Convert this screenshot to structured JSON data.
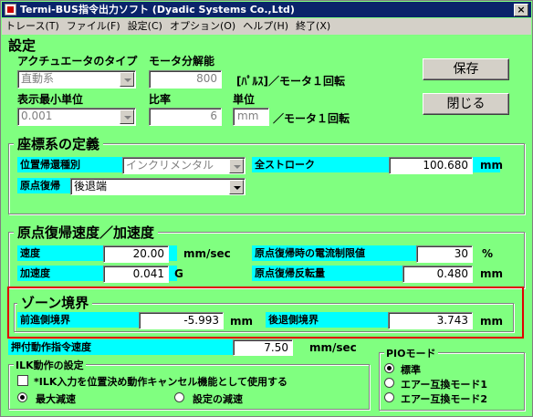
{
  "window": {
    "title": "Termi-BUS指令出力ソフト (Dyadic Systems Co.,Ltd)",
    "close": "×"
  },
  "menu": [
    "トレース(T)",
    "ファイル(F)",
    "設定(C)",
    "オプション(O)",
    "ヘルプ(H)",
    "終了(X)"
  ],
  "settings": {
    "title": "設定",
    "actuator_type_label": "アクチュエータのタイプ",
    "actuator_type_value": "直動系",
    "motor_resolution_label": "モータ分解能",
    "motor_resolution_value": "800",
    "pulse_unit": "[ﾊﾟﾙｽ]／モータ１回転",
    "min_unit_label": "表示最小単位",
    "min_unit_value": "0.001",
    "ratio_label": "比率",
    "ratio_value": "6",
    "unit_label": "単位",
    "unit_value": "mm",
    "unit_suffix": "／モータ１回転",
    "save_button": "保存",
    "close_button": "閉じる"
  },
  "coord": {
    "title": "座標系の定義",
    "pos_return_label": "位置帰還種別",
    "pos_return_value": "インクリメンタル",
    "full_stroke_label": "全ストローク",
    "full_stroke_value": "100.680",
    "full_stroke_unit": "mm",
    "origin_return_label": "原点復帰",
    "origin_return_value": "後退端"
  },
  "origin_speed": {
    "title": "原点復帰速度／加速度",
    "speed_label": "速度",
    "speed_value": "20.00",
    "speed_unit": "mm/sec",
    "current_limit_label": "原点復帰時の電流制限値",
    "current_limit_value": "30",
    "current_limit_unit": "%",
    "accel_label": "加速度",
    "accel_value": "0.041",
    "accel_unit": "G",
    "reverse_label": "原点復帰反転量",
    "reverse_value": "0.480",
    "reverse_unit": "mm"
  },
  "zone": {
    "title": "ゾーン境界",
    "forward_label": "前進側境界",
    "forward_value": "-5.993",
    "forward_unit": "mm",
    "backward_label": "後退側境界",
    "backward_value": "3.743",
    "backward_unit": "mm"
  },
  "push": {
    "label": "押付動作指令速度",
    "value": "7.50",
    "unit": "mm/sec"
  },
  "ilk": {
    "title": "ILK動作の設定",
    "checkbox_label": "*ILK入力を位置決め動作キャンセル機能として使用する",
    "radio_max": "最大減速",
    "radio_set": "設定の減速"
  },
  "pio": {
    "title": "PIOモード",
    "options": [
      "標準",
      "エアー互換モード1",
      "エアー互換モード2"
    ]
  },
  "colors": {
    "background": "#80ff80",
    "label_bg": "#00ffff",
    "highlight": "#e00000"
  }
}
